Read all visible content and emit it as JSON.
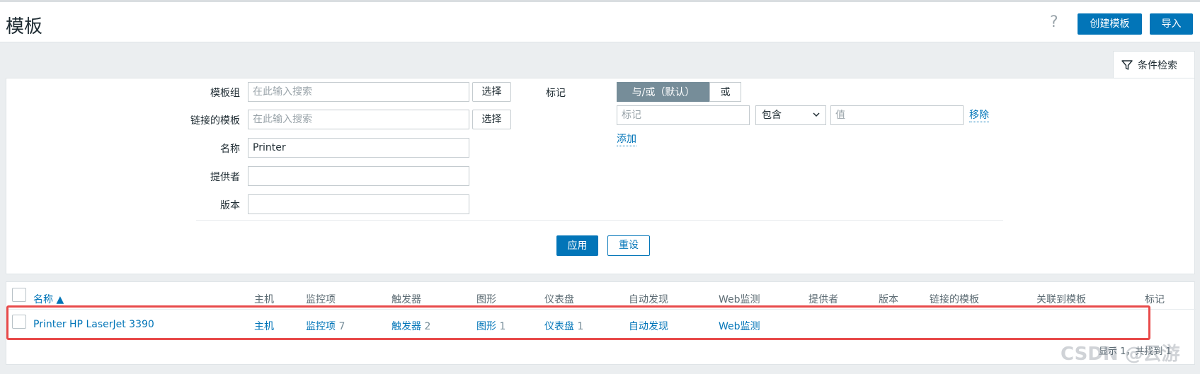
{
  "header": {
    "title": "模板",
    "help": "?",
    "create_label": "创建模板",
    "import_label": "导入"
  },
  "filter_tab": {
    "label": "条件检索"
  },
  "filter": {
    "template_group": {
      "label": "模板组",
      "placeholder": "在此输入搜索",
      "select_label": "选择"
    },
    "linked_templates": {
      "label": "链接的模板",
      "placeholder": "在此输入搜索",
      "select_label": "选择"
    },
    "name": {
      "label": "名称",
      "value": "Printer"
    },
    "vendor": {
      "label": "提供者",
      "value": ""
    },
    "version": {
      "label": "版本",
      "value": ""
    },
    "tags": {
      "label": "标记",
      "mode_andor": "与/或（默认）",
      "mode_or": "或",
      "tag_placeholder": "标记",
      "operator": "包含",
      "value_placeholder": "值",
      "remove_label": "移除",
      "add_label": "添加"
    },
    "apply_label": "应用",
    "reset_label": "重设"
  },
  "table": {
    "columns": [
      "名称 ▲",
      "主机",
      "监控项",
      "触发器",
      "图形",
      "仪表盘",
      "自动发现",
      "Web监测",
      "提供者",
      "版本",
      "链接的模板",
      "关联到模板",
      "标记"
    ],
    "rows": [
      {
        "name": "Printer HP LaserJet 3390",
        "hosts": "主机",
        "items": "监控项",
        "items_count": "7",
        "triggers": "触发器",
        "triggers_count": "2",
        "graphs": "图形",
        "graphs_count": "1",
        "dashboards": "仪表盘",
        "dashboards_count": "1",
        "discovery": "自动发现",
        "web": "Web监测"
      }
    ]
  },
  "pager": "显示 1，共找到 1",
  "watermark": "CSDN @云游"
}
